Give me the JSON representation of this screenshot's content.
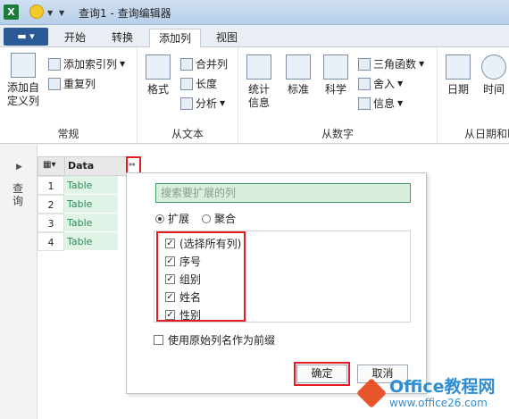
{
  "window": {
    "title": "查询1 - 查询编辑器"
  },
  "tabs": [
    {
      "label": "开始"
    },
    {
      "label": "转换"
    },
    {
      "label": "添加列"
    },
    {
      "label": "视图"
    }
  ],
  "active_tab": "添加列",
  "ribbon": {
    "groups": {
      "general": {
        "label": "常规",
        "add_custom_column": "添加自定义列",
        "add_index_column": "添加索引列",
        "duplicate_column": "重复列"
      },
      "from_text": {
        "label": "从文本",
        "format": "格式",
        "merge_columns": "合并列",
        "length": "长度",
        "parse": "分析"
      },
      "from_number": {
        "label": "从数字",
        "statistics": "统计信息",
        "standard": "标准",
        "scientific": "科学",
        "trigonometry": "三角函数",
        "rounding": "舍入",
        "information": "信息"
      },
      "from_datetime": {
        "label": "从日期和时",
        "date": "日期",
        "time": "时间"
      }
    }
  },
  "left_pane": {
    "label": "查询"
  },
  "grid": {
    "column_header": "Data",
    "rows": [
      {
        "num": "1",
        "value": "Table"
      },
      {
        "num": "2",
        "value": "Table"
      },
      {
        "num": "3",
        "value": "Table"
      },
      {
        "num": "4",
        "value": "Table"
      }
    ]
  },
  "expand_popup": {
    "search_placeholder": "搜索要扩展的列",
    "mode_expand": "扩展",
    "mode_aggregate": "聚合",
    "columns": [
      {
        "label": "(选择所有列)",
        "checked": true
      },
      {
        "label": "序号",
        "checked": true
      },
      {
        "label": "组别",
        "checked": true
      },
      {
        "label": "姓名",
        "checked": true
      },
      {
        "label": "性别",
        "checked": true
      }
    ],
    "use_prefix": "使用原始列名作为前缀",
    "ok": "确定",
    "cancel": "取消"
  },
  "watermark": {
    "line1": "Office教程网",
    "line2": "www.office26.com"
  }
}
